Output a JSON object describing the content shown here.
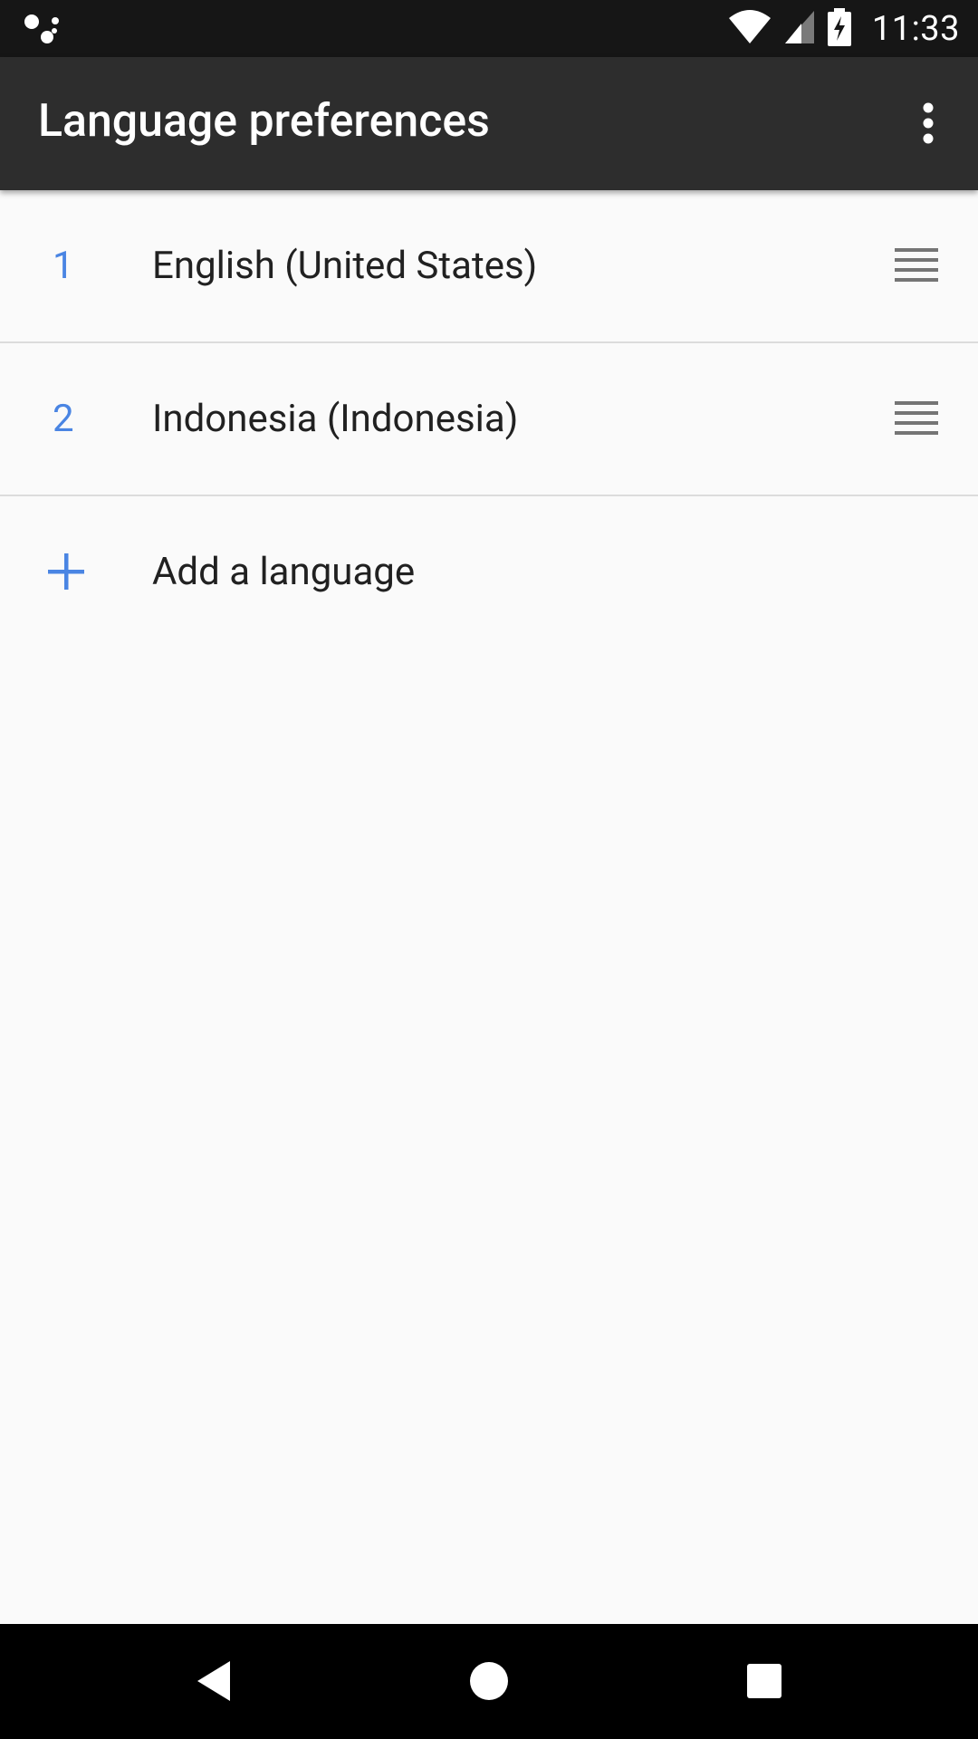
{
  "status_bar": {
    "time": "11:33",
    "icons": [
      "assistant-dots-icon",
      "wifi-icon",
      "signal-icon",
      "battery-charging-icon"
    ]
  },
  "app_bar": {
    "title": "Language preferences",
    "menu_icon": "overflow-menu-icon"
  },
  "languages": [
    {
      "number": "1",
      "label": "English (United States)",
      "handle_icon": "drag-handle-icon"
    },
    {
      "number": "2",
      "label": "Indonesia (Indonesia)",
      "handle_icon": "drag-handle-icon"
    }
  ],
  "add_language": {
    "label": "Add a language",
    "icon": "plus-icon"
  },
  "nav_bar": {
    "icons": [
      "back-icon",
      "home-icon",
      "recents-icon"
    ]
  },
  "colors": {
    "accent": "#4a85e3",
    "app_bar": "#2d2d2d",
    "status_bar": "#161616",
    "background": "#fafafa",
    "text_primary": "#212121"
  }
}
